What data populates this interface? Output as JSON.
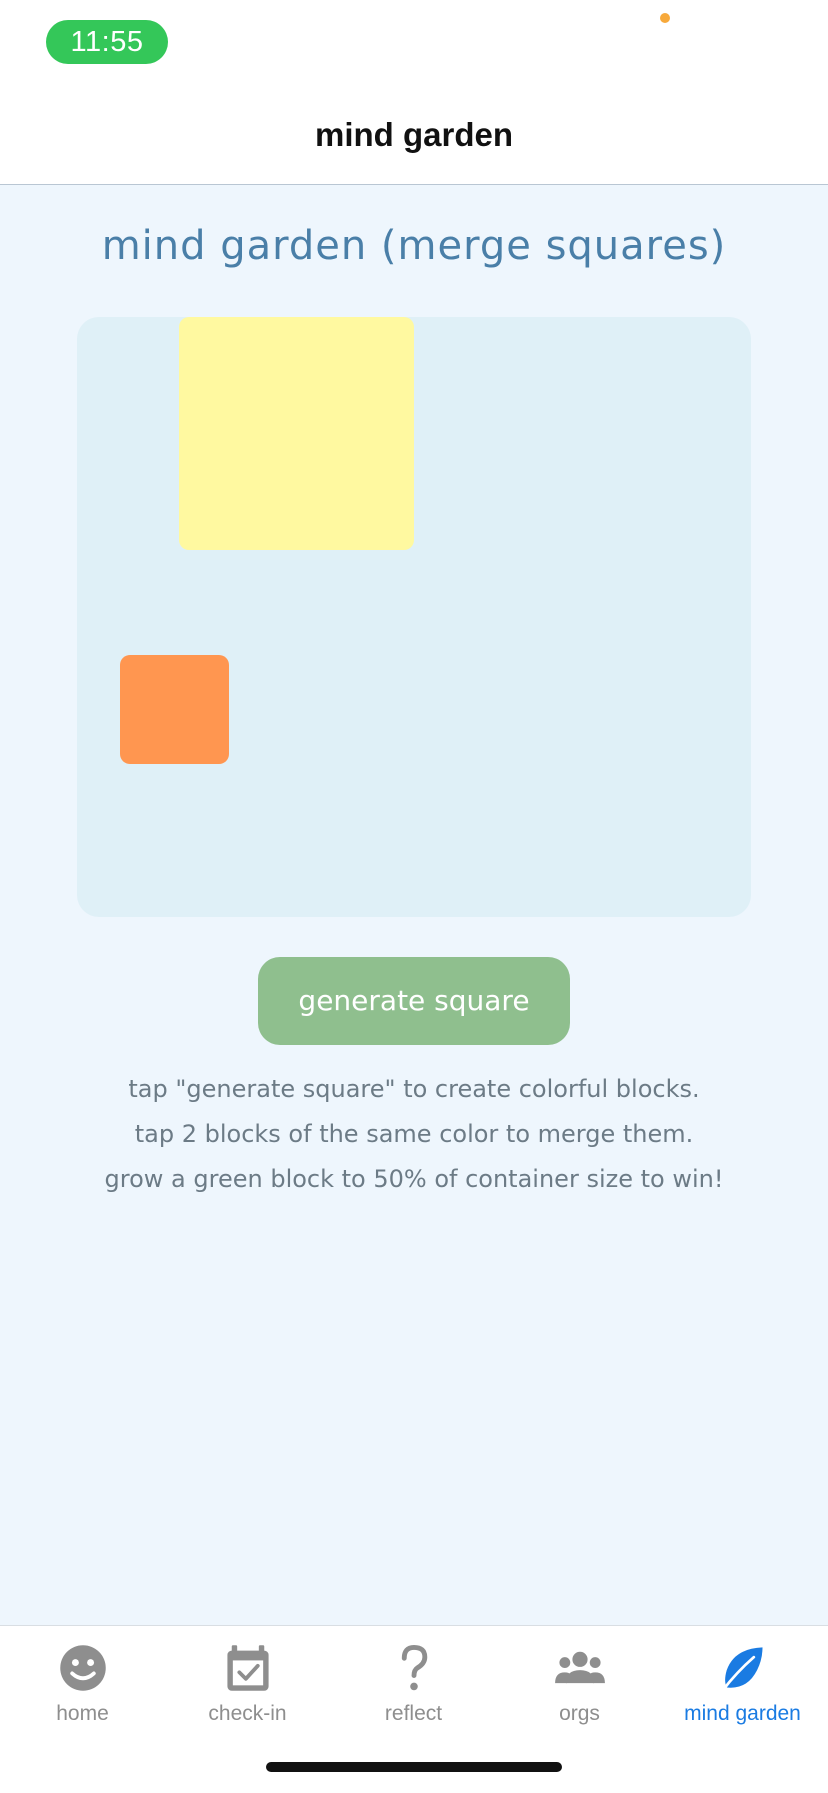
{
  "status_bar": {
    "time": "11:55"
  },
  "nav": {
    "title": "mind garden"
  },
  "game": {
    "title": "mind garden (merge squares)",
    "blocks": [
      {
        "color": "#fff9a0",
        "color_name": "yellow"
      },
      {
        "color": "#ff9650",
        "color_name": "orange"
      }
    ],
    "button_label": "generate square",
    "instructions": [
      "tap \"generate square\" to create colorful blocks.",
      "tap 2 blocks of the same color to merge them.",
      "grow a green block to 50% of container size to win!"
    ]
  },
  "tabs": [
    {
      "label": "home",
      "icon": "smiley-icon",
      "active": false
    },
    {
      "label": "check-in",
      "icon": "calendar-check-icon",
      "active": false
    },
    {
      "label": "reflect",
      "icon": "question-icon",
      "active": false
    },
    {
      "label": "orgs",
      "icon": "people-icon",
      "active": false
    },
    {
      "label": "mind garden",
      "icon": "leaf-icon",
      "active": true
    }
  ],
  "colors": {
    "accent": "#1a7be2",
    "time_pill": "#34c759",
    "button": "#8fbf8e",
    "board": "#dff0f7",
    "title": "#4a7fa8"
  }
}
